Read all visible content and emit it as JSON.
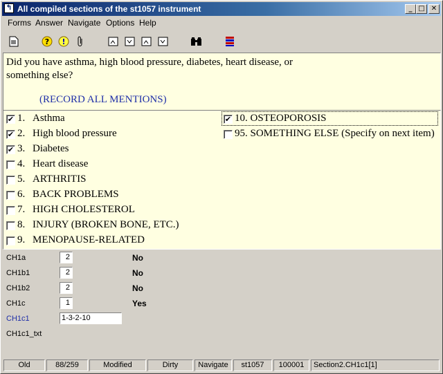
{
  "window": {
    "title": "All compiled sections of the st1057 instrument",
    "minimize": "_",
    "maximize": "□",
    "close": "✕"
  },
  "menu": [
    {
      "label": "Forms"
    },
    {
      "label": "Answer"
    },
    {
      "label": "Navigate"
    },
    {
      "label": "Options"
    },
    {
      "label": "Help"
    }
  ],
  "toolbar": [
    {
      "icon": "document-icon"
    },
    {
      "icon": "help-question-icon"
    },
    {
      "icon": "info-exclamation-icon"
    },
    {
      "icon": "paperclip-icon"
    },
    {
      "icon": "form-nav-first-icon"
    },
    {
      "icon": "form-nav-prev-icon"
    },
    {
      "icon": "form-nav-next-icon"
    },
    {
      "icon": "form-nav-last-icon"
    },
    {
      "icon": "search-binoculars-icon"
    },
    {
      "icon": "flag-icon"
    }
  ],
  "question": {
    "text": "Did you have asthma, high blood pressure, diabetes, heart disease, or something else?",
    "instruction": "(RECORD ALL MENTIONS)"
  },
  "options": [
    {
      "num": "1.",
      "label": "Asthma",
      "checked": true
    },
    {
      "num": "2.",
      "label": "High blood pressure",
      "checked": true
    },
    {
      "num": "3.",
      "label": "Diabetes",
      "checked": true
    },
    {
      "num": "4.",
      "label": "Heart disease",
      "checked": false
    },
    {
      "num": "5.",
      "label": "ARTHRITIS",
      "checked": false
    },
    {
      "num": "6.",
      "label": "BACK PROBLEMS",
      "checked": false
    },
    {
      "num": "7.",
      "label": "HIGH CHOLESTEROL",
      "checked": false
    },
    {
      "num": "8.",
      "label": "INJURY (BROKEN BONE, ETC.)",
      "checked": false
    },
    {
      "num": "9.",
      "label": "MENOPAUSE-RELATED",
      "checked": false
    },
    {
      "num": "",
      "label": "10. OSTEOPOROSIS",
      "checked": true
    },
    {
      "num": "",
      "label": "95. SOMETHING ELSE (Specify on next item)",
      "checked": false
    }
  ],
  "fields": [
    {
      "name": "CH1a",
      "value": "2",
      "answer": "No"
    },
    {
      "name": "CH1b1",
      "value": "2",
      "answer": "No"
    },
    {
      "name": "CH1b2",
      "value": "2",
      "answer": "No"
    },
    {
      "name": "CH1c",
      "value": "1",
      "answer": "Yes"
    },
    {
      "name": "CH1c1",
      "value": "1-3-2-10",
      "answer": ""
    },
    {
      "name": "CH1c1_txt",
      "value": "",
      "answer": ""
    }
  ],
  "status": [
    "Old",
    "88/259",
    "Modified",
    "Dirty",
    "Navigate",
    "st1057",
    "100001",
    "Section2.CH1c1[1]"
  ]
}
